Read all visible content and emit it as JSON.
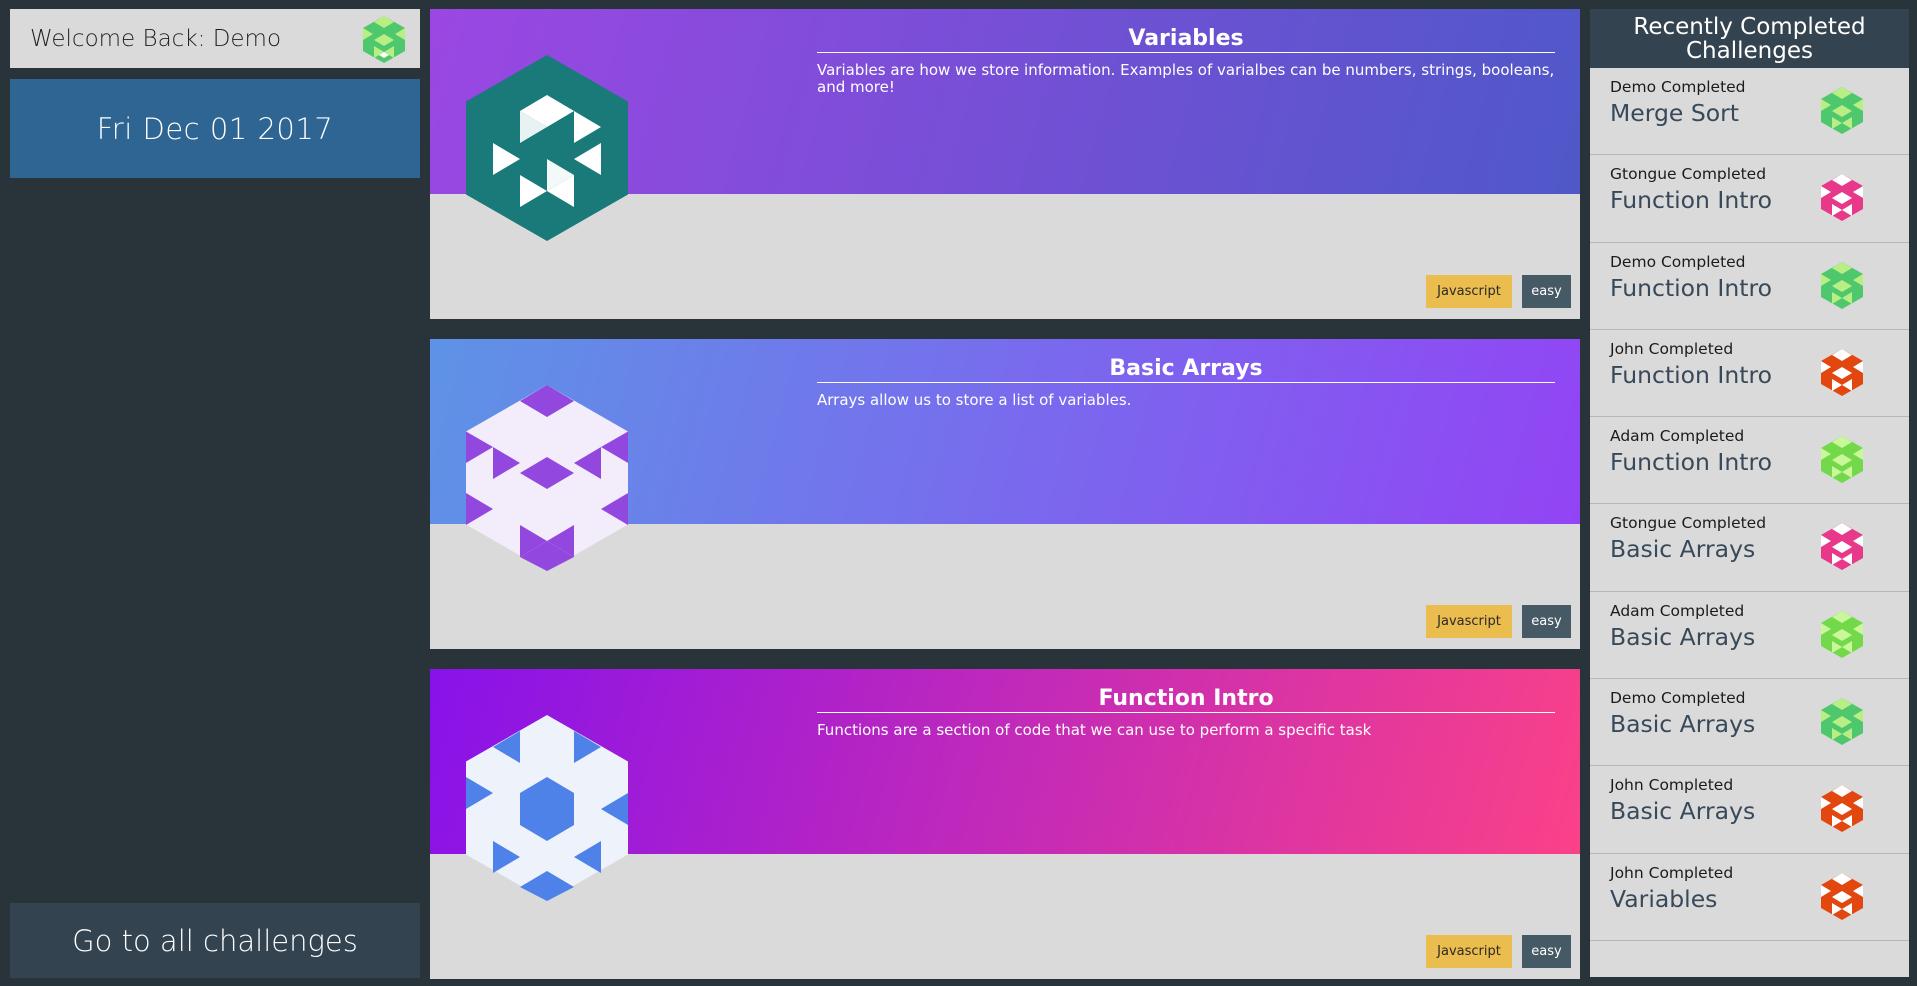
{
  "sidebar": {
    "welcome": "Welcome Back: Demo",
    "avatar_icon": "identicon-green",
    "date": "Fri Dec 01 2017",
    "all_challenges": "Go to all challenges"
  },
  "cards": [
    {
      "title": "Variables",
      "description": "Variables are how we store information. Examples of varialbes can be numbers, strings, booleans, and more!",
      "language": "Javascript",
      "difficulty": "easy",
      "banner_from": "#9b47e3",
      "banner_to": "#4f58c8",
      "icon": "identicon-teal"
    },
    {
      "title": "Basic Arrays",
      "description": "Arrays allow us to store a list of variables.",
      "language": "Javascript",
      "difficulty": "easy",
      "banner_from": "#5e93e6",
      "banner_to": "#9244f4",
      "icon": "identicon-purple"
    },
    {
      "title": "Function Intro",
      "description": "Functions are a section of code that we can use to perform a specific task",
      "language": "Javascript",
      "difficulty": "easy",
      "banner_from": "#8812ea",
      "banner_to": "#fb4188",
      "icon": "identicon-blue"
    }
  ],
  "recent": {
    "header": "Recently Completed Challenges",
    "items": [
      {
        "user": "Demo Completed",
        "challenge": "Merge Sort",
        "avatar": "identicon-green"
      },
      {
        "user": "Gtongue Completed",
        "challenge": "Function Intro",
        "avatar": "identicon-pink"
      },
      {
        "user": "Demo Completed",
        "challenge": "Function Intro",
        "avatar": "identicon-green"
      },
      {
        "user": "John Completed",
        "challenge": "Function Intro",
        "avatar": "identicon-orange"
      },
      {
        "user": "Adam Completed",
        "challenge": "Function Intro",
        "avatar": "identicon-lime"
      },
      {
        "user": "Gtongue Completed",
        "challenge": "Basic Arrays",
        "avatar": "identicon-pink"
      },
      {
        "user": "Adam Completed",
        "challenge": "Basic Arrays",
        "avatar": "identicon-lime"
      },
      {
        "user": "Demo Completed",
        "challenge": "Basic Arrays",
        "avatar": "identicon-green"
      },
      {
        "user": "John Completed",
        "challenge": "Basic Arrays",
        "avatar": "identicon-orange"
      },
      {
        "user": "John Completed",
        "challenge": "Variables",
        "avatar": "identicon-orange"
      }
    ]
  },
  "colors": {
    "background": "#29333a",
    "panel": "#dadada",
    "date_bg": "#2e6593",
    "dark_header": "#344350",
    "tag_lang": "#ebbc4e",
    "tag_level": "#455a64"
  }
}
